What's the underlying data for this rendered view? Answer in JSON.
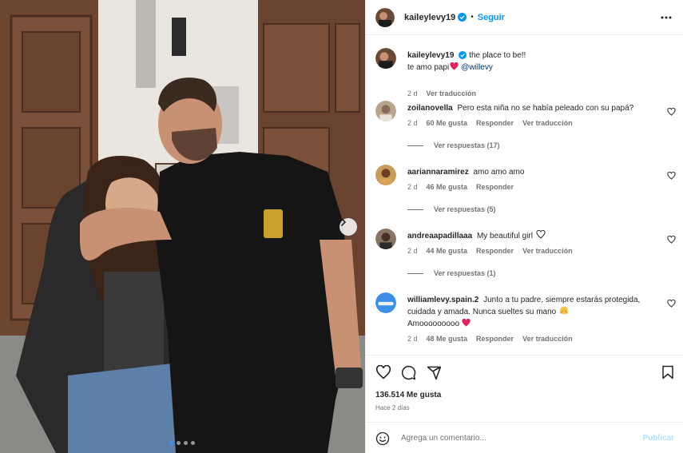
{
  "post": {
    "author": "kaileylevy19",
    "follow_label": "Seguir",
    "separator": "•",
    "caption_line1": "the place to be!!",
    "caption_line2_text": "te amo papi",
    "caption_mention": "@willevy",
    "caption_time": "2 d",
    "translate_label": "Ver traducción"
  },
  "comments": [
    {
      "username": "zoilanovella",
      "text": "Pero esta niña no se había peleado con su papá?",
      "time": "2 d",
      "likes": "60 Me gusta",
      "reply": "Responder",
      "translate": "Ver traducción",
      "replies": "Ver respuestas (17)"
    },
    {
      "username": "aariannaramirez",
      "text": "amo amo amo",
      "time": "2 d",
      "likes": "46 Me gusta",
      "reply": "Responder",
      "replies": "Ver respuestas (5)"
    },
    {
      "username": "andreaapadillaaa",
      "text": "My beautiful girl",
      "time": "2 d",
      "likes": "44 Me gusta",
      "reply": "Responder",
      "translate": "Ver traducción",
      "replies": "Ver respuestas (1)"
    },
    {
      "username": "williamlevy.spain.2",
      "text": "Junto a tu padre, siempre estarás protegida, cuidada y amada. Nunca sueltes su mano",
      "text2": "Amooooooooo",
      "time": "2 d",
      "likes": "48 Me gusta",
      "reply": "Responder",
      "translate": "Ver traducción"
    }
  ],
  "stats": {
    "likes": "136.514 Me gusta",
    "ago": "Hace 2 días"
  },
  "composer": {
    "placeholder": "Agrega un comentario...",
    "post_label": "Publicar"
  },
  "carousel": {
    "count": 4,
    "active": 0
  },
  "icons": [
    "verified-badge-icon",
    "more-options-icon",
    "heart-icon",
    "comment-icon",
    "share-icon",
    "save-icon",
    "emoji-icon",
    "chevron-right-icon"
  ],
  "colors": {
    "accent": "#0095f6",
    "text": "#262626",
    "muted": "#737373",
    "heart_red": "#e0245e"
  }
}
